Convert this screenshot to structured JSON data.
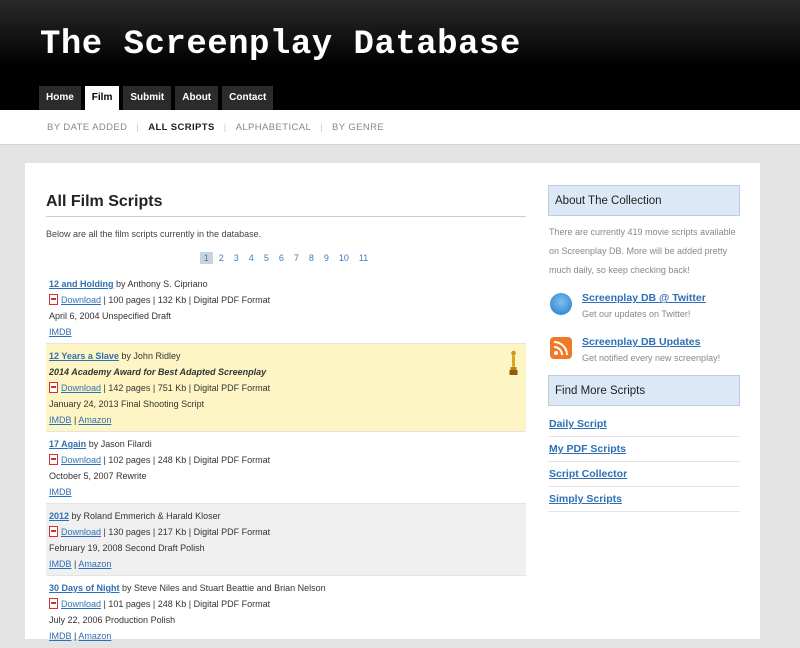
{
  "site": {
    "title": "The Screenplay Database"
  },
  "nav": {
    "tabs": [
      "Home",
      "Film",
      "Submit",
      "About",
      "Contact"
    ],
    "active": "Film"
  },
  "subnav": {
    "items": [
      "BY DATE ADDED",
      "ALL SCRIPTS",
      "ALPHABETICAL",
      "BY GENRE"
    ],
    "active": "ALL SCRIPTS"
  },
  "main": {
    "title": "All Film Scripts",
    "intro": "Below are all the film scripts currently in the database.",
    "pages": [
      "1",
      "2",
      "3",
      "4",
      "5",
      "6",
      "7",
      "8",
      "9",
      "10",
      "11"
    ],
    "current_page": "1",
    "entries": [
      {
        "title": "12 and Holding",
        "by": "by Anthony S. Cipriano",
        "download": "Download",
        "details": "| 100 pages | 132 Kb | Digital PDF Format",
        "date": "April 6, 2004 Unspecified Draft",
        "imdb": "IMDB",
        "sep": "|",
        "amazon": ""
      },
      {
        "title": "12 Years a Slave",
        "by": "by John Ridley",
        "award": "2014 Academy Award for Best Adapted Screenplay",
        "download": "Download",
        "details": "| 142 pages | 751 Kb | Digital PDF Format",
        "date": "January 24, 2013 Final Shooting Script",
        "imdb": "IMDB",
        "sep": "|",
        "amazon": "Amazon"
      },
      {
        "title": "17 Again",
        "by": "by Jason Filardi",
        "download": "Download",
        "details": "| 102 pages | 248 Kb | Digital PDF Format",
        "date": "October 5, 2007 Rewrite",
        "imdb": "IMDB",
        "sep": "|",
        "amazon": ""
      },
      {
        "title": "2012",
        "by": "by Roland Emmerich & Harald Kloser",
        "download": "Download",
        "details": "| 130 pages | 217 Kb | Digital PDF Format",
        "date": "February 19, 2008 Second Draft Polish",
        "imdb": "IMDB",
        "sep": "|",
        "amazon": "Amazon"
      },
      {
        "title": "30 Days of Night",
        "by": "by Steve Niles and Stuart Beattie and Brian Nelson",
        "download": "Download",
        "details": "| 101 pages | 248 Kb | Digital PDF Format",
        "date": "July 22, 2006 Production Polish",
        "imdb": "IMDB",
        "sep": "|",
        "amazon": "Amazon"
      }
    ]
  },
  "sidebar": {
    "about_title": "About The Collection",
    "about_text": "There are currently 419 movie scripts available on Screenplay DB. More will be added pretty much daily, so keep checking back!",
    "twitter": {
      "title": "Screenplay DB @ Twitter",
      "sub": "Get our updates on Twitter!"
    },
    "rss": {
      "title": "Screenplay DB Updates",
      "sub": "Get notified every new screenplay!"
    },
    "find_title": "Find More Scripts",
    "links": [
      "Daily Script",
      "My PDF Scripts",
      "Script Collector",
      "Simply Scripts"
    ]
  }
}
